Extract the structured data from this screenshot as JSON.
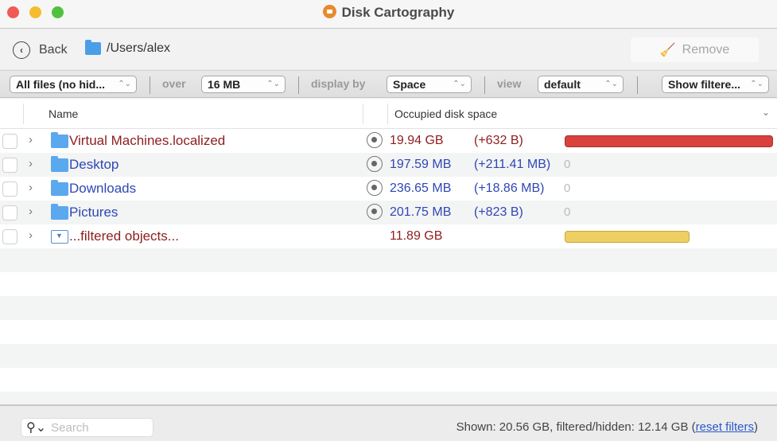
{
  "window": {
    "title": "Disk Cartography"
  },
  "nav": {
    "back_label": "Back",
    "path": "/Users/alex",
    "remove_label": "Remove"
  },
  "filters": {
    "file_filter": "All files (no hid...",
    "over_label": "over",
    "size_threshold": "16 MB",
    "display_by_label": "display by",
    "display_by": "Space",
    "view_label": "view",
    "view": "default",
    "show_filtered": "Show filtere..."
  },
  "table": {
    "columns": {
      "name": "Name",
      "occupied": "Occupied disk space"
    },
    "rows": [
      {
        "name": "Virtual Machines.localized",
        "size": "19.94 GB",
        "delta": "(+632 B)",
        "zero": "",
        "bar_fraction": 1.0,
        "bar_color": "#d9413c",
        "text_color": "red"
      },
      {
        "name": "Desktop",
        "size": "197.59 MB",
        "delta": "(+211.41 MB)",
        "zero": "0",
        "bar_fraction": 0,
        "text_color": "blue"
      },
      {
        "name": "Downloads",
        "size": "236.65 MB",
        "delta": "(+18.86 MB)",
        "zero": "0",
        "bar_fraction": 0,
        "text_color": "blue"
      },
      {
        "name": "Pictures",
        "size": "201.75 MB",
        "delta": "(+823 B)",
        "zero": "0",
        "bar_fraction": 0,
        "text_color": "blue"
      },
      {
        "name": "...filtered objects...",
        "size": "11.89 GB",
        "delta": "",
        "zero": "",
        "bar_fraction": 0.6,
        "bar_color": "#f0cf62",
        "text_color": "red"
      }
    ]
  },
  "footer": {
    "search_placeholder": "Search",
    "status_text": "Shown: 20.56 GB, filtered/hidden: 12.14 GB (",
    "reset_link": "reset filters",
    "status_close": ")"
  }
}
